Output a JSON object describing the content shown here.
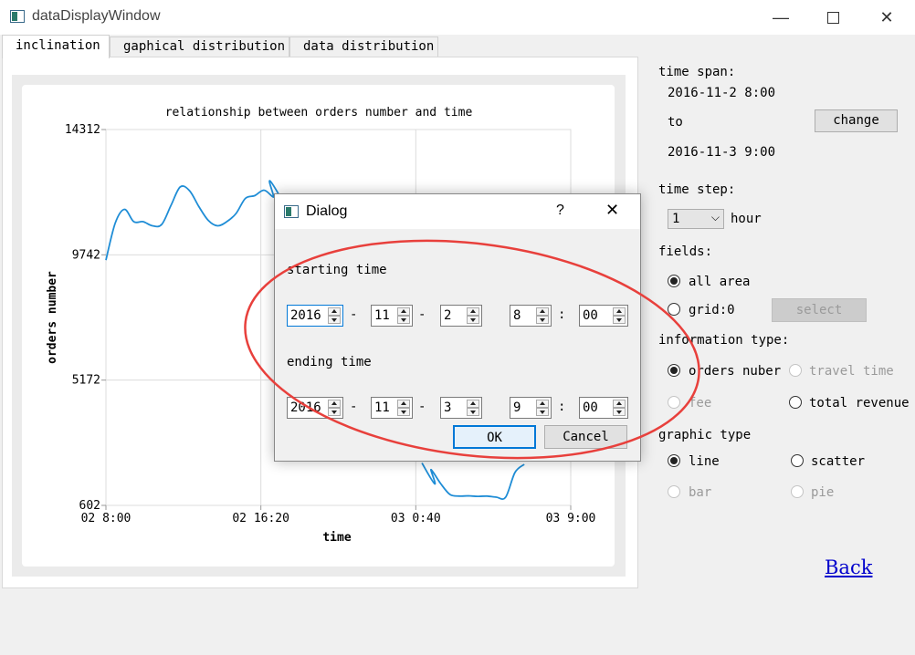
{
  "window": {
    "title": "dataDisplayWindow"
  },
  "tabs": [
    {
      "label": "inclination",
      "active": true
    },
    {
      "label": "gaphical distribution",
      "active": false
    },
    {
      "label": "data distribution",
      "active": false
    }
  ],
  "chart_data": {
    "type": "line",
    "title": "relationship between orders number and time",
    "xlabel": "time",
    "ylabel": "orders number",
    "x_ticks": [
      "02 8:00",
      "02 16:20",
      "03 0:40",
      "03 9:00"
    ],
    "y_ticks": [
      "14312",
      "9742",
      "5172",
      "602"
    ],
    "ylim": [
      602,
      14312
    ],
    "xlim_hours": [
      0,
      25
    ],
    "grid": true,
    "color": "#1f8dd6",
    "series": [
      {
        "x": [
          0,
          0.5,
          1,
          1.5,
          2,
          2.5,
          3,
          3.5,
          4,
          4.5,
          5,
          5.5,
          6,
          6.5,
          7,
          7.5,
          8,
          8.5,
          9,
          9.5,
          17,
          17.5,
          18,
          18.5,
          19,
          19.5,
          20,
          20.5,
          21,
          21.5,
          22,
          22.5
        ],
        "y": [
          9550,
          10900,
          11400,
          10950,
          10950,
          10800,
          10850,
          11550,
          12220,
          12080,
          11500,
          11000,
          10800,
          10950,
          11250,
          11800,
          11900,
          12100,
          11850,
          11700,
          2150,
          1900,
          1400,
          1000,
          940,
          950,
          930,
          940,
          900,
          900,
          1800,
          2100
        ]
      }
    ]
  },
  "panel": {
    "time_span_label": "time span:",
    "start_time": "2016-11-2 8:00",
    "to_label": "to",
    "end_time": "2016-11-3 9:00",
    "change_label": "change",
    "time_step_label": "time step:",
    "time_step_value": "1",
    "hour_label": "hour",
    "fields_label": "fields:",
    "all_area_label": "all area",
    "grid_label": "grid:0",
    "select_label": "select",
    "info_type_label": "information type:",
    "orders_label": "orders nuber",
    "travel_label": "travel time",
    "fee_label": "fee",
    "revenue_label": "total revenue",
    "graphic_type_label": "graphic type",
    "line_label": "line",
    "scatter_label": "scatter",
    "bar_label": "bar",
    "pie_label": "pie",
    "back_label": "Back"
  },
  "dialog": {
    "title": "Dialog",
    "help": "?",
    "starting_label": "starting time",
    "ending_label": "ending time",
    "start": {
      "year": "2016",
      "month": "11",
      "day": "2",
      "hour": "8",
      "minute": "00"
    },
    "end": {
      "year": "2016",
      "month": "11",
      "day": "3",
      "hour": "9",
      "minute": "00"
    },
    "dash": "-",
    "colon": ":",
    "ok_label": "OK",
    "cancel_label": "Cancel"
  },
  "colors": {
    "accent": "#1f8dd6",
    "annotation": "#e8403c",
    "link": "#0000cc"
  }
}
